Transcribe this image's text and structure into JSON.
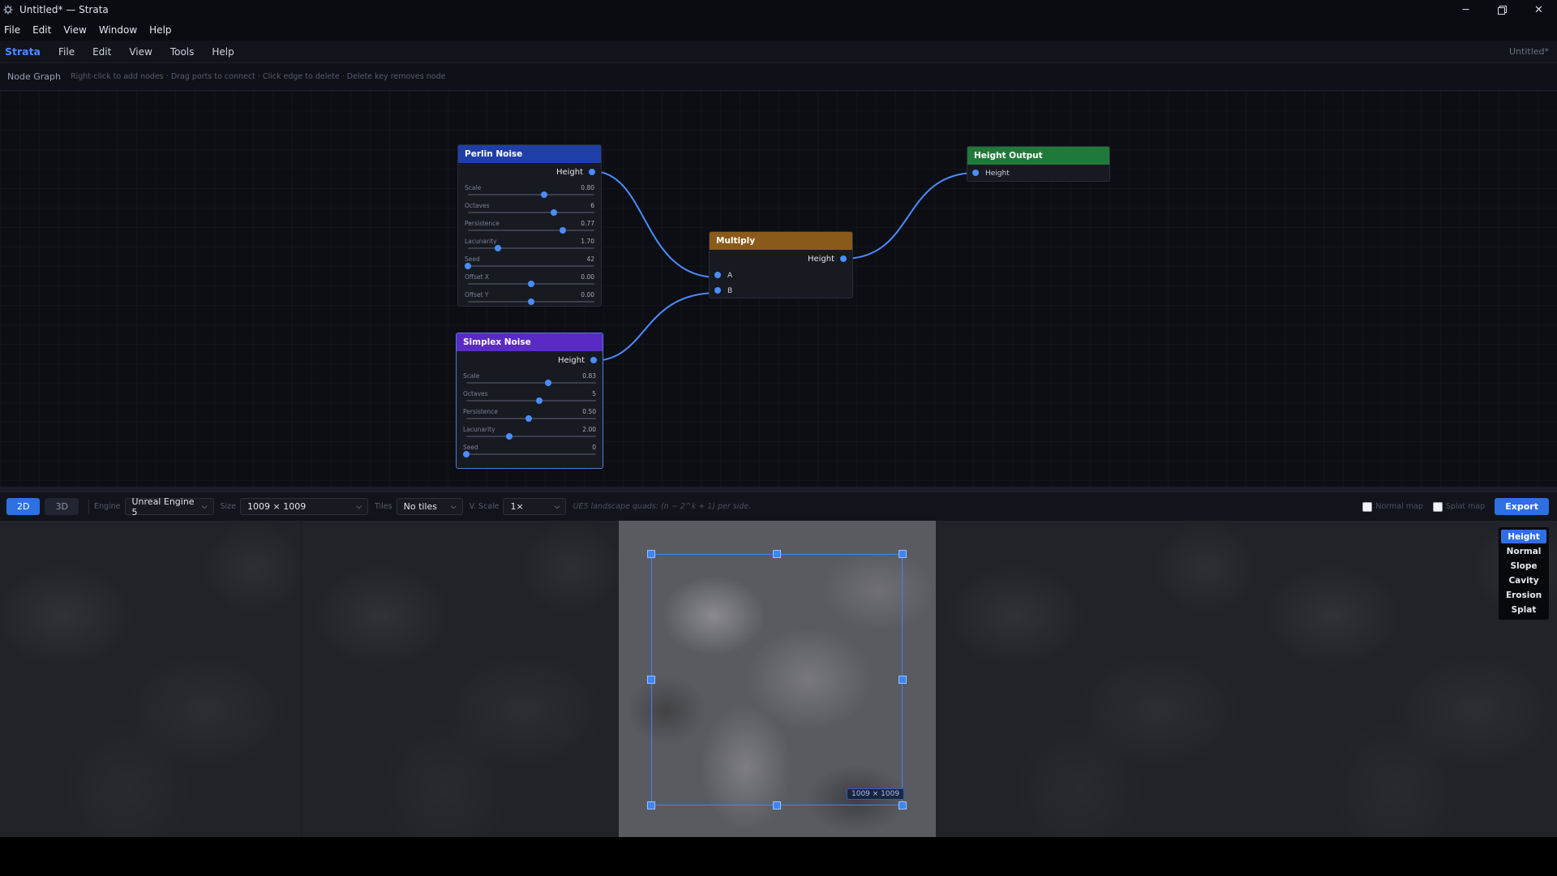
{
  "window": {
    "title": "Untitled* — Strata"
  },
  "os_menu": [
    "File",
    "Edit",
    "View",
    "Window",
    "Help"
  ],
  "app_menu": {
    "brand": "Strata",
    "items": [
      "File",
      "Edit",
      "View",
      "Tools",
      "Help"
    ],
    "document": "Untitled*"
  },
  "graph_header": {
    "label": "Node Graph",
    "hint": "Right-click to add nodes · Drag ports to connect · Click edge to delete · Delete key removes node"
  },
  "nodes": {
    "perlin": {
      "title": "Perlin Noise",
      "output": "Height",
      "color": "#1f3fa8",
      "params": [
        {
          "label": "Scale",
          "value": "0.80",
          "level": 0.6
        },
        {
          "label": "Octaves",
          "value": "6",
          "level": 0.68
        },
        {
          "label": "Persistence",
          "value": "0.77",
          "level": 0.75
        },
        {
          "label": "Lacunarity",
          "value": "1.70",
          "level": 0.24
        },
        {
          "label": "Seed",
          "value": "42",
          "level": 0.0
        },
        {
          "label": "Offset X",
          "value": "0.00",
          "level": 0.5
        },
        {
          "label": "Offset Y",
          "value": "0.00",
          "level": 0.5
        }
      ]
    },
    "simplex": {
      "title": "Simplex Noise",
      "output": "Height",
      "color": "#5a2bc4",
      "params": [
        {
          "label": "Scale",
          "value": "0.83",
          "level": 0.63
        },
        {
          "label": "Octaves",
          "value": "5",
          "level": 0.56
        },
        {
          "label": "Persistence",
          "value": "0.50",
          "level": 0.48
        },
        {
          "label": "Lacunarity",
          "value": "2.00",
          "level": 0.33
        },
        {
          "label": "Seed",
          "value": "0",
          "level": 0.0
        }
      ]
    },
    "multiply": {
      "title": "Multiply",
      "output": "Height",
      "inputs": [
        "A",
        "B"
      ],
      "color": "#8a5a1a"
    },
    "height_output": {
      "title": "Height Output",
      "input": "Height",
      "color": "#1f7a3a"
    }
  },
  "toolbar": {
    "view_2d": "2D",
    "view_3d": "3D",
    "engine_label": "Engine",
    "engine_value": "Unreal Engine 5",
    "size_label": "Size",
    "size_value": "1009 × 1009",
    "tiles_label": "Tiles",
    "tiles_value": "No tiles",
    "vscale_label": "V. Scale",
    "vscale_value": "1×",
    "note": "UE5 landscape quads: (n − 2^k + 1) per side.",
    "normal_map_label": "Normal map",
    "splat_map_label": "Splat map",
    "export_label": "Export"
  },
  "viewport": {
    "selection_size": "1009 × 1009",
    "modes": [
      "Height",
      "Normal",
      "Slope",
      "Cavity",
      "Erosion",
      "Splat"
    ],
    "active_mode": "Height"
  },
  "colors": {
    "accent": "#2f6fe4",
    "port": "#4a8dff",
    "edge": "#4a8dff"
  }
}
